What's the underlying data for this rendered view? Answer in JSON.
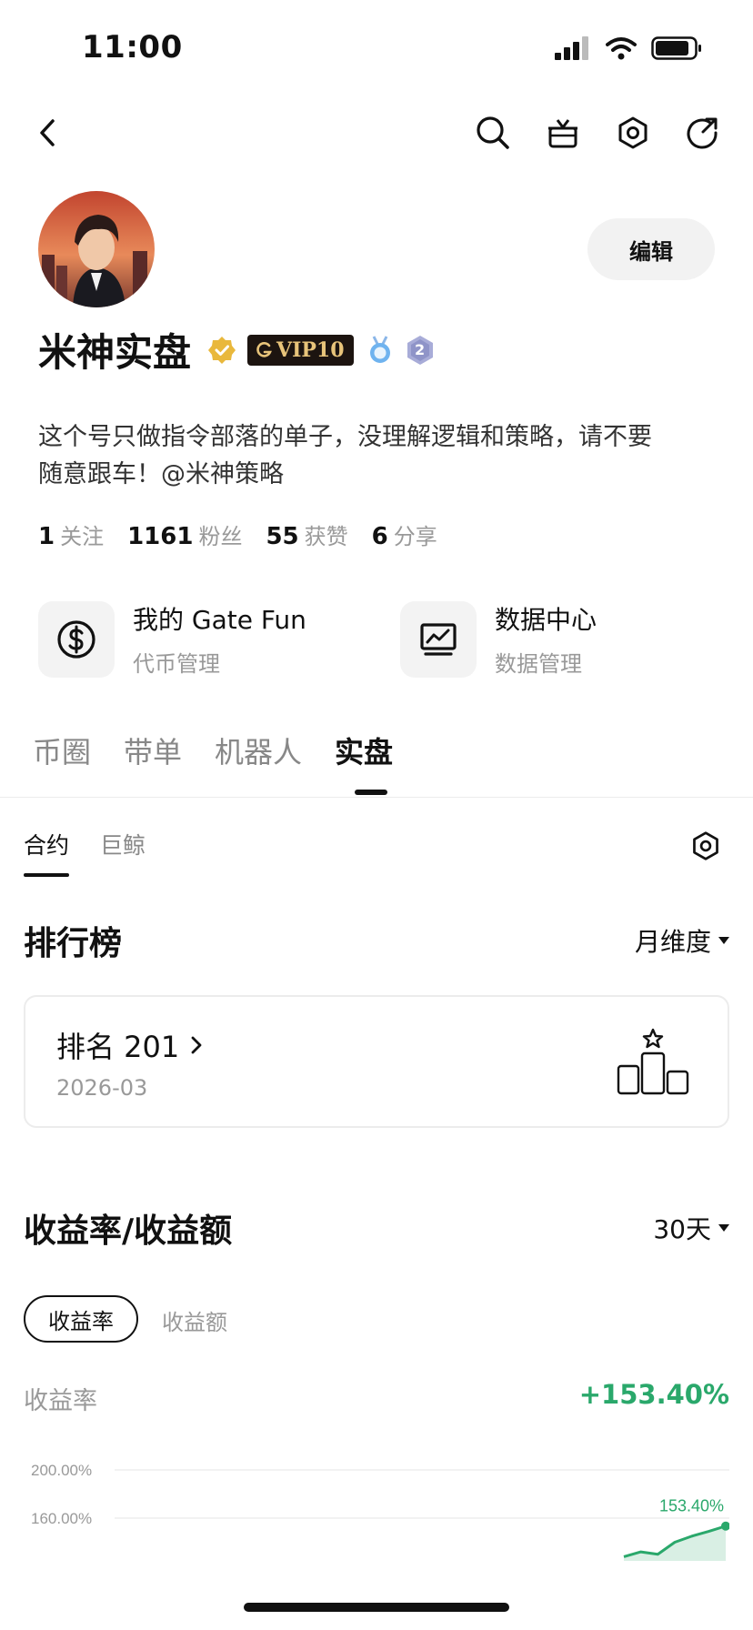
{
  "status_bar": {
    "time": "11:00"
  },
  "profile": {
    "edit_label": "编辑",
    "name": "米神实盘",
    "vip_label": "VIP10",
    "level_badge": "2",
    "bio_line1": "这个号只做指令部落的单子，没理解逻辑和策略，请不要",
    "bio_line2": "随意跟车！@米神策略",
    "stats": [
      {
        "value": "1",
        "label": "关注"
      },
      {
        "value": "1161",
        "label": "粉丝"
      },
      {
        "value": "55",
        "label": "获赞"
      },
      {
        "value": "6",
        "label": "分享"
      }
    ]
  },
  "tools": [
    {
      "title": "我的 Gate Fun",
      "subtitle": "代币管理",
      "icon": "dollar-coin-icon"
    },
    {
      "title": "数据中心",
      "subtitle": "数据管理",
      "icon": "chart-monitor-icon"
    }
  ],
  "tabs": [
    "币圈",
    "带单",
    "机器人",
    "实盘"
  ],
  "active_tab": "实盘",
  "subtabs": [
    "合约",
    "巨鲸"
  ],
  "leaderboard": {
    "title": "排行榜",
    "period": "月维度",
    "rank_label": "排名 201",
    "rank_date": "2026-03"
  },
  "returns": {
    "title": "收益率/收益额",
    "period": "30天",
    "toggle_active": "收益率",
    "toggle_inactive": "收益额",
    "metric_label": "收益率",
    "metric_value": "+153.40%"
  },
  "colors": {
    "positive": "#2aa86b",
    "vip_gold": "#e8c47a"
  },
  "chart_data": {
    "type": "area",
    "y_ticks": [
      "200.00%",
      "160.00%"
    ],
    "ylim": [
      120,
      200
    ],
    "x": [
      1,
      2,
      3,
      4,
      5,
      6,
      7
    ],
    "values": [
      128,
      132,
      130,
      140,
      145,
      149,
      153.4
    ],
    "last_label": "153.40%"
  }
}
